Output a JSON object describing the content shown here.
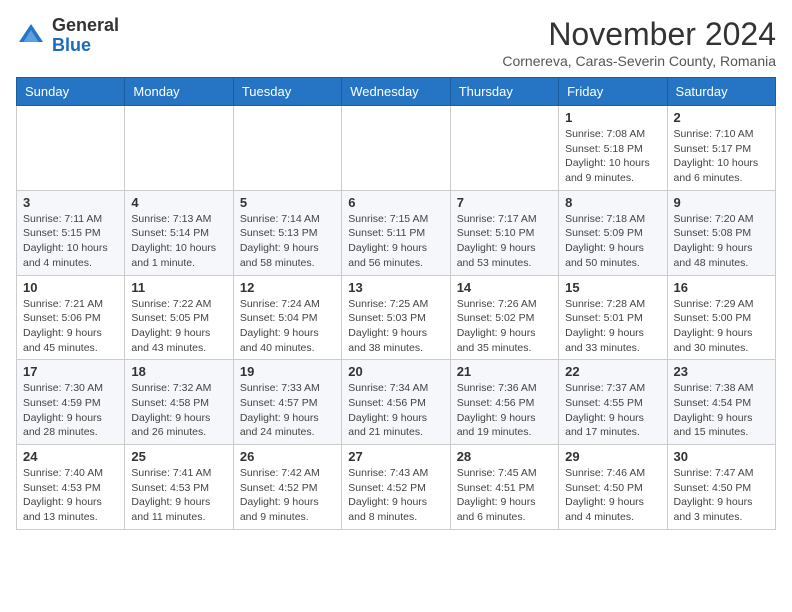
{
  "logo": {
    "general": "General",
    "blue": "Blue"
  },
  "title": "November 2024",
  "subtitle": "Cornereva, Caras-Severin County, Romania",
  "days_of_week": [
    "Sunday",
    "Monday",
    "Tuesday",
    "Wednesday",
    "Thursday",
    "Friday",
    "Saturday"
  ],
  "weeks": [
    [
      {
        "day": "",
        "info": ""
      },
      {
        "day": "",
        "info": ""
      },
      {
        "day": "",
        "info": ""
      },
      {
        "day": "",
        "info": ""
      },
      {
        "day": "",
        "info": ""
      },
      {
        "day": "1",
        "info": "Sunrise: 7:08 AM\nSunset: 5:18 PM\nDaylight: 10 hours and 9 minutes."
      },
      {
        "day": "2",
        "info": "Sunrise: 7:10 AM\nSunset: 5:17 PM\nDaylight: 10 hours and 6 minutes."
      }
    ],
    [
      {
        "day": "3",
        "info": "Sunrise: 7:11 AM\nSunset: 5:15 PM\nDaylight: 10 hours and 4 minutes."
      },
      {
        "day": "4",
        "info": "Sunrise: 7:13 AM\nSunset: 5:14 PM\nDaylight: 10 hours and 1 minute."
      },
      {
        "day": "5",
        "info": "Sunrise: 7:14 AM\nSunset: 5:13 PM\nDaylight: 9 hours and 58 minutes."
      },
      {
        "day": "6",
        "info": "Sunrise: 7:15 AM\nSunset: 5:11 PM\nDaylight: 9 hours and 56 minutes."
      },
      {
        "day": "7",
        "info": "Sunrise: 7:17 AM\nSunset: 5:10 PM\nDaylight: 9 hours and 53 minutes."
      },
      {
        "day": "8",
        "info": "Sunrise: 7:18 AM\nSunset: 5:09 PM\nDaylight: 9 hours and 50 minutes."
      },
      {
        "day": "9",
        "info": "Sunrise: 7:20 AM\nSunset: 5:08 PM\nDaylight: 9 hours and 48 minutes."
      }
    ],
    [
      {
        "day": "10",
        "info": "Sunrise: 7:21 AM\nSunset: 5:06 PM\nDaylight: 9 hours and 45 minutes."
      },
      {
        "day": "11",
        "info": "Sunrise: 7:22 AM\nSunset: 5:05 PM\nDaylight: 9 hours and 43 minutes."
      },
      {
        "day": "12",
        "info": "Sunrise: 7:24 AM\nSunset: 5:04 PM\nDaylight: 9 hours and 40 minutes."
      },
      {
        "day": "13",
        "info": "Sunrise: 7:25 AM\nSunset: 5:03 PM\nDaylight: 9 hours and 38 minutes."
      },
      {
        "day": "14",
        "info": "Sunrise: 7:26 AM\nSunset: 5:02 PM\nDaylight: 9 hours and 35 minutes."
      },
      {
        "day": "15",
        "info": "Sunrise: 7:28 AM\nSunset: 5:01 PM\nDaylight: 9 hours and 33 minutes."
      },
      {
        "day": "16",
        "info": "Sunrise: 7:29 AM\nSunset: 5:00 PM\nDaylight: 9 hours and 30 minutes."
      }
    ],
    [
      {
        "day": "17",
        "info": "Sunrise: 7:30 AM\nSunset: 4:59 PM\nDaylight: 9 hours and 28 minutes."
      },
      {
        "day": "18",
        "info": "Sunrise: 7:32 AM\nSunset: 4:58 PM\nDaylight: 9 hours and 26 minutes."
      },
      {
        "day": "19",
        "info": "Sunrise: 7:33 AM\nSunset: 4:57 PM\nDaylight: 9 hours and 24 minutes."
      },
      {
        "day": "20",
        "info": "Sunrise: 7:34 AM\nSunset: 4:56 PM\nDaylight: 9 hours and 21 minutes."
      },
      {
        "day": "21",
        "info": "Sunrise: 7:36 AM\nSunset: 4:56 PM\nDaylight: 9 hours and 19 minutes."
      },
      {
        "day": "22",
        "info": "Sunrise: 7:37 AM\nSunset: 4:55 PM\nDaylight: 9 hours and 17 minutes."
      },
      {
        "day": "23",
        "info": "Sunrise: 7:38 AM\nSunset: 4:54 PM\nDaylight: 9 hours and 15 minutes."
      }
    ],
    [
      {
        "day": "24",
        "info": "Sunrise: 7:40 AM\nSunset: 4:53 PM\nDaylight: 9 hours and 13 minutes."
      },
      {
        "day": "25",
        "info": "Sunrise: 7:41 AM\nSunset: 4:53 PM\nDaylight: 9 hours and 11 minutes."
      },
      {
        "day": "26",
        "info": "Sunrise: 7:42 AM\nSunset: 4:52 PM\nDaylight: 9 hours and 9 minutes."
      },
      {
        "day": "27",
        "info": "Sunrise: 7:43 AM\nSunset: 4:52 PM\nDaylight: 9 hours and 8 minutes."
      },
      {
        "day": "28",
        "info": "Sunrise: 7:45 AM\nSunset: 4:51 PM\nDaylight: 9 hours and 6 minutes."
      },
      {
        "day": "29",
        "info": "Sunrise: 7:46 AM\nSunset: 4:50 PM\nDaylight: 9 hours and 4 minutes."
      },
      {
        "day": "30",
        "info": "Sunrise: 7:47 AM\nSunset: 4:50 PM\nDaylight: 9 hours and 3 minutes."
      }
    ]
  ]
}
